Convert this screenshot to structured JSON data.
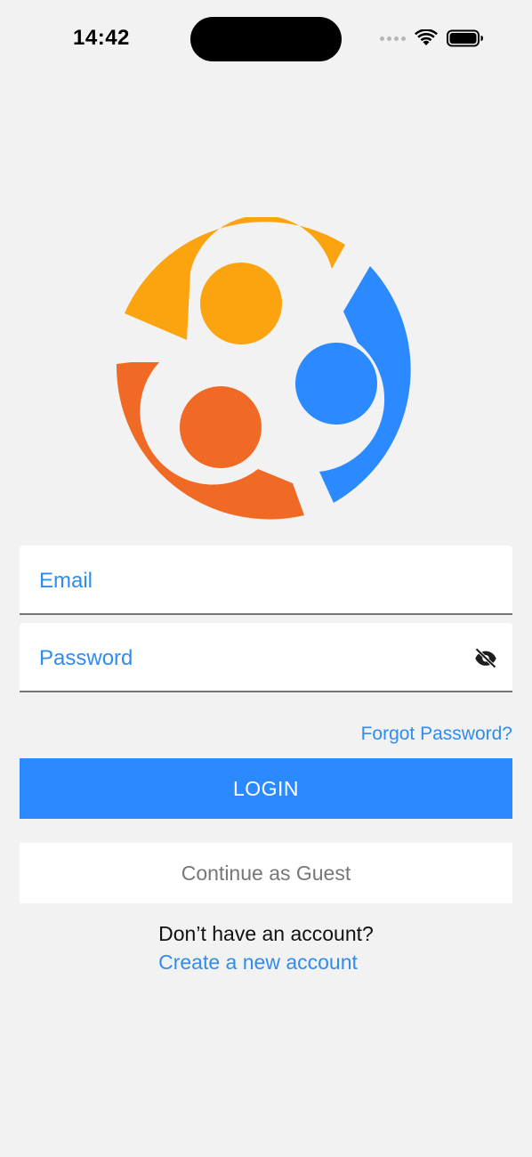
{
  "status_bar": {
    "time": "14:42",
    "icons": [
      "signal-dots-icon",
      "wifi-icon",
      "battery-icon"
    ]
  },
  "logo": {
    "icon": "community-logo",
    "colors": {
      "orange_top": "#fca310",
      "blue_right": "#2b8aff",
      "red_orange_left": "#f06a25"
    }
  },
  "form": {
    "email_label": "Email",
    "password_label": "Password",
    "password_toggle_icon": "eye-off-icon",
    "forgot_password": "Forgot Password?"
  },
  "actions": {
    "login_label": "LOGIN",
    "guest_label": "Continue as Guest"
  },
  "signup": {
    "prompt": "Don’t have an account?",
    "link": "Create a new account"
  },
  "colors": {
    "accent": "#2b8aff",
    "background": "#f2f2f2"
  }
}
